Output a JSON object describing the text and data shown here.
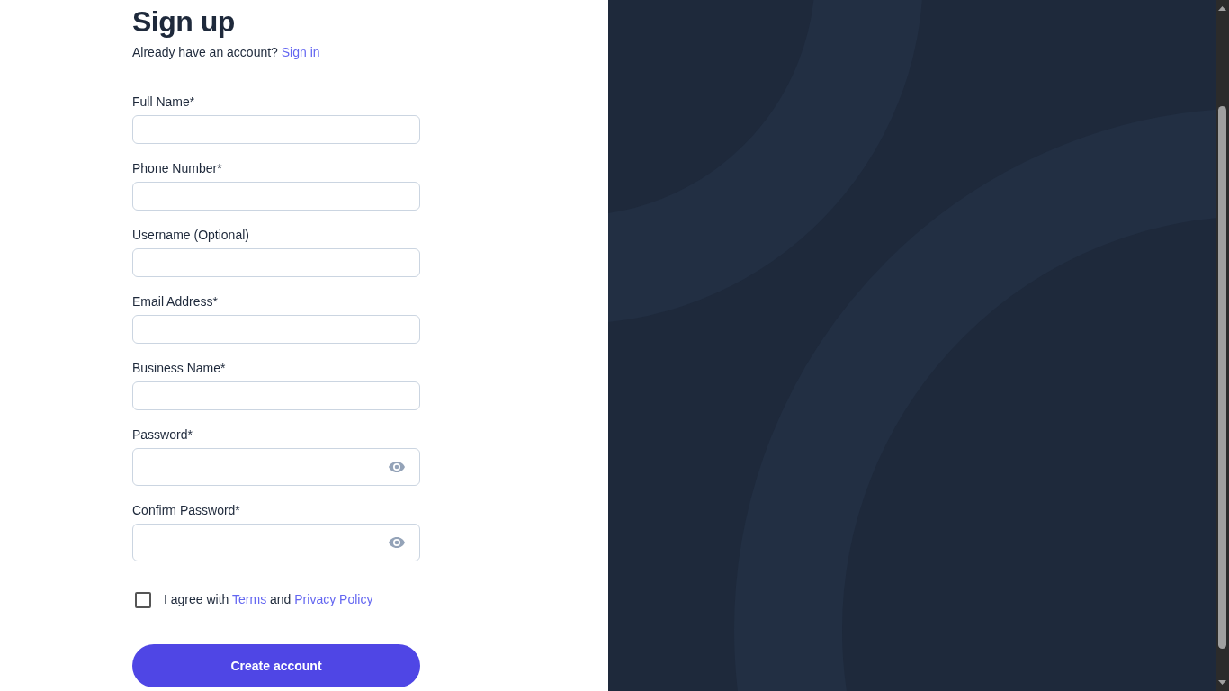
{
  "title": "Sign up",
  "signin_prompt": {
    "text": "Already have an account?",
    "link": "Sign in"
  },
  "fields": [
    {
      "label": "Full Name*",
      "kind": "text"
    },
    {
      "label": "Phone Number*",
      "kind": "text"
    },
    {
      "label": "Username (Optional)",
      "kind": "text"
    },
    {
      "label": "Email Address*",
      "kind": "text"
    },
    {
      "label": "Business Name*",
      "kind": "text"
    },
    {
      "label": "Password*",
      "kind": "password"
    },
    {
      "label": "Confirm Password*",
      "kind": "password"
    }
  ],
  "agreement": {
    "checked": false,
    "text_before": "I agree with",
    "terms_link": "Terms",
    "text_middle": "and",
    "privacy_link": "Privacy Policy"
  },
  "submit_button": "Create account"
}
